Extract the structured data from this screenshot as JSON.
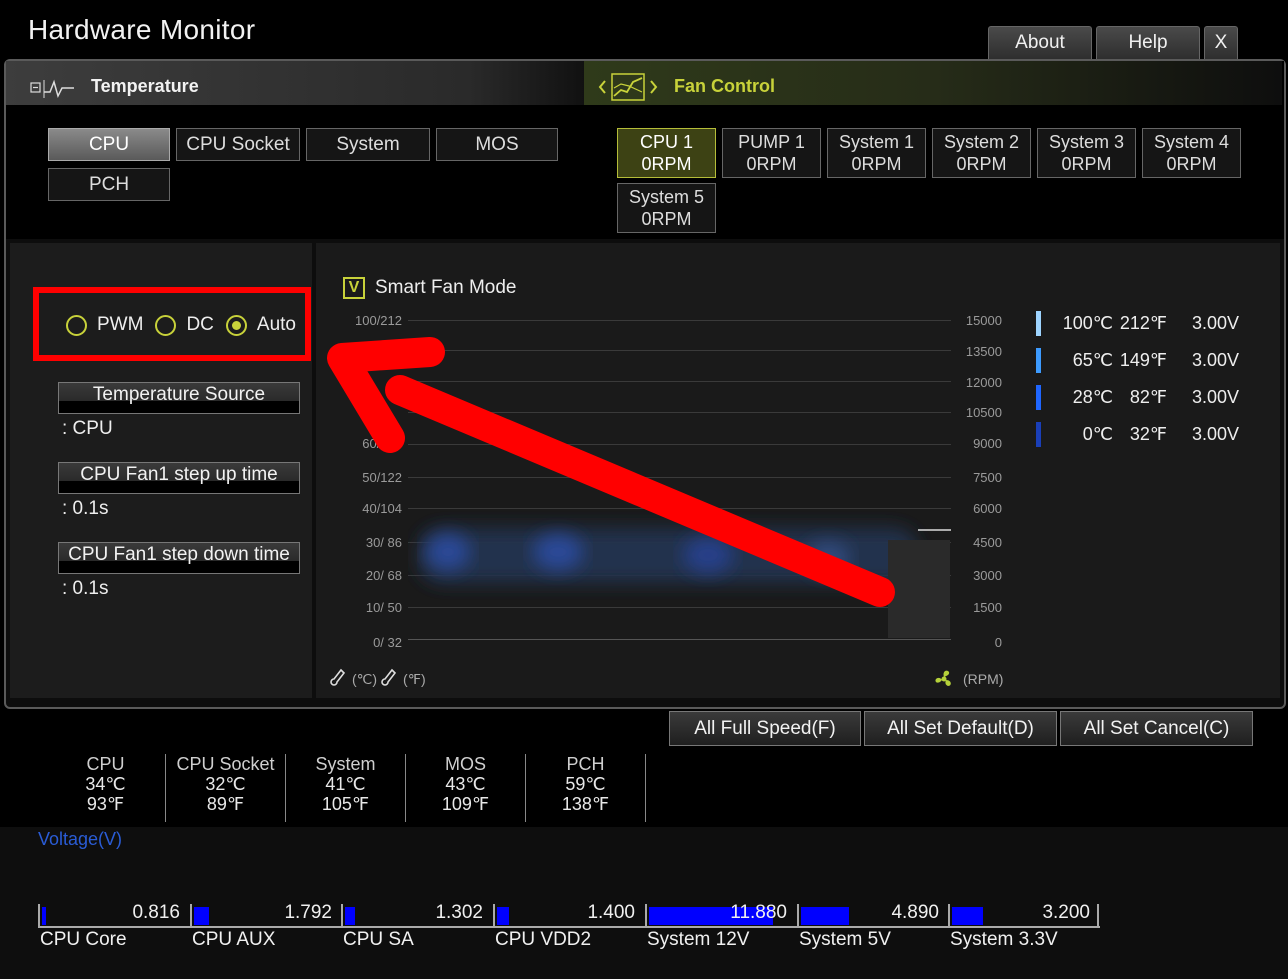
{
  "window": {
    "title": "Hardware Monitor"
  },
  "top_buttons": {
    "about": "About",
    "help": "Help",
    "close": "X"
  },
  "temperature": {
    "header": "Temperature",
    "sources": [
      "CPU",
      "CPU Socket",
      "System",
      "MOS",
      "PCH"
    ],
    "selected": "CPU"
  },
  "fan_control": {
    "header": "Fan Control",
    "fans": [
      {
        "name": "CPU 1",
        "rpm": "0RPM"
      },
      {
        "name": "PUMP 1",
        "rpm": "0RPM"
      },
      {
        "name": "System 1",
        "rpm": "0RPM"
      },
      {
        "name": "System 2",
        "rpm": "0RPM"
      },
      {
        "name": "System 3",
        "rpm": "0RPM"
      },
      {
        "name": "System 4",
        "rpm": "0RPM"
      },
      {
        "name": "System 5",
        "rpm": "0RPM"
      }
    ],
    "selected": "CPU 1"
  },
  "mode": {
    "options": [
      "PWM",
      "DC",
      "Auto"
    ],
    "selected": "Auto"
  },
  "settings": {
    "temperature_source_label": "Temperature Source",
    "temperature_source_value": ": CPU",
    "step_up_label": "CPU Fan1 step up time",
    "step_up_value": ": 0.1s",
    "step_down_label": "CPU Fan1 step down time",
    "step_down_value": ": 0.1s"
  },
  "graph": {
    "smart_fan_label": "Smart Fan Mode",
    "smart_fan_checked": "V",
    "left_ticks": [
      "100/212",
      "60/140",
      "50/122",
      "40/104",
      "30/  86",
      "20/  68",
      "10/  50",
      "0/  32"
    ],
    "right_ticks": [
      "15000",
      "13500",
      "12000",
      "10500",
      "9000",
      "7500",
      "6000",
      "4500",
      "3000",
      "1500",
      "0"
    ],
    "left_unit_c": "(℃)",
    "left_unit_f": "(℉)",
    "right_unit": "(RPM)",
    "legend": [
      {
        "c": "100℃",
        "f": "212℉",
        "v": "3.00V",
        "color": "#9ed4ff"
      },
      {
        "c": "65℃",
        "f": "149℉",
        "v": "3.00V",
        "color": "#3d9bff"
      },
      {
        "c": "28℃",
        "f": "82℉",
        "v": "3.00V",
        "color": "#1f66ff"
      },
      {
        "c": "0℃",
        "f": "32℉",
        "v": "3.00V",
        "color": "#1a3fb8"
      }
    ]
  },
  "actions": {
    "full_speed": "All Full Speed(F)",
    "set_default": "All Set Default(D)",
    "set_cancel": "All Set Cancel(C)"
  },
  "readings": [
    {
      "name": "CPU",
      "c": "34℃",
      "f": "93℉"
    },
    {
      "name": "CPU Socket",
      "c": "32℃",
      "f": "89℉"
    },
    {
      "name": "System",
      "c": "41℃",
      "f": "105℉"
    },
    {
      "name": "MOS",
      "c": "43℃",
      "f": "109℉"
    },
    {
      "name": "PCH",
      "c": "59℃",
      "f": "138℉"
    }
  ],
  "voltage": {
    "title": "Voltage(V)",
    "items": [
      {
        "name": "CPU Core",
        "value": "0.816",
        "fill": 0.03
      },
      {
        "name": "CPU AUX",
        "value": "1.792",
        "fill": 0.1
      },
      {
        "name": "CPU SA",
        "value": "1.302",
        "fill": 0.07
      },
      {
        "name": "CPU VDD2",
        "value": "1.400",
        "fill": 0.08
      },
      {
        "name": "System 12V",
        "value": "11.880",
        "fill": 0.85
      },
      {
        "name": "System 5V",
        "value": "4.890",
        "fill": 0.33
      },
      {
        "name": "System 3.3V",
        "value": "3.200",
        "fill": 0.21
      }
    ]
  },
  "colors": {
    "accent": "#c8d23a",
    "annotation": "#ff0000",
    "voltage_fill": "#0000ff"
  }
}
